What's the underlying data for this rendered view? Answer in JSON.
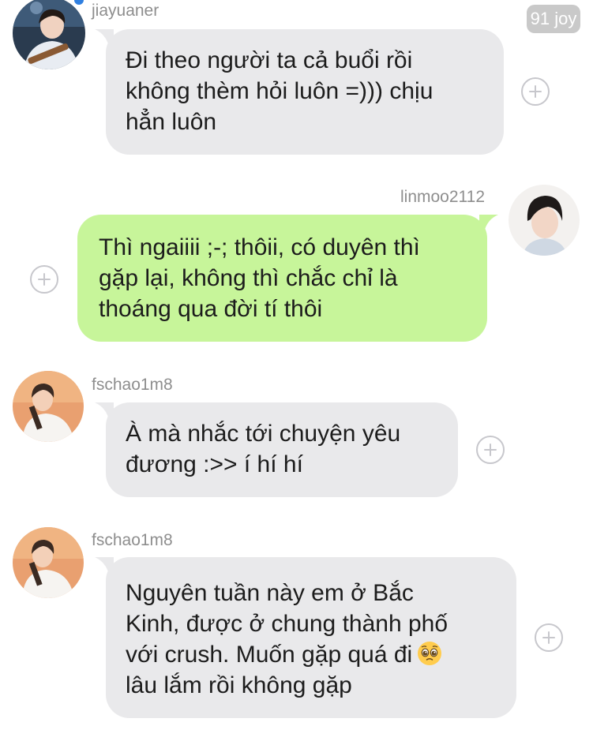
{
  "watermark": "91 joy",
  "messages": [
    {
      "username": "jiayuaner",
      "direction": "incoming",
      "lines": [
        "Đi theo người ta cả buổi rồi",
        "không thèm hỏi luôn =))) chịu",
        "hẳn luôn"
      ]
    },
    {
      "username": "linmoo2112",
      "direction": "outgoing",
      "lines": [
        "Thì ngaiiii ;-; thôii, có duyên thì",
        "gặp lại, không thì chắc chỉ là",
        "thoáng qua đời tí thôi"
      ]
    },
    {
      "username": "fschao1m8",
      "direction": "incoming",
      "lines": [
        "À mà nhắc tới chuyện yêu",
        "đương :>> í hí hí"
      ]
    },
    {
      "username": "fschao1m8",
      "direction": "incoming",
      "lines": [
        "Nguyên tuần này em ở Bắc",
        "Kinh, được ở chung thành phố",
        "với crush. Muốn gặp quá đi",
        "lâu lắm rồi không gặp"
      ],
      "emoji": "pleading-face-icon"
    }
  ],
  "colors": {
    "incoming_bubble": "#e9e9eb",
    "outgoing_bubble": "#c7f59a",
    "username_text": "#8e8e8e",
    "add_icon": "#c7c7cc",
    "badge": "#c9c9c9"
  }
}
